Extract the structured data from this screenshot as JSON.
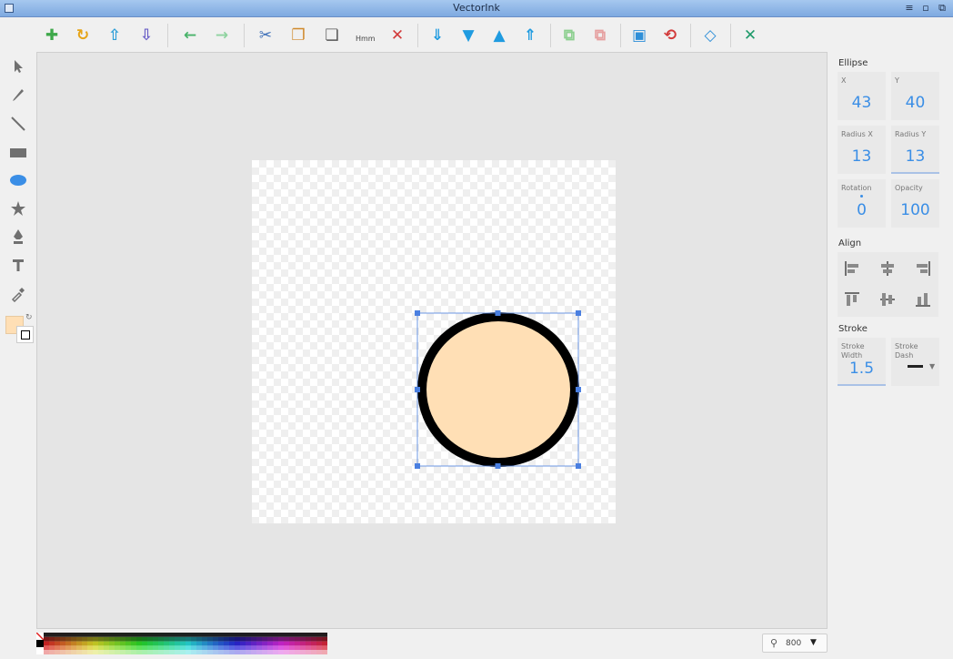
{
  "window": {
    "title": "VectorInk"
  },
  "toolbar": {
    "buttons": [
      {
        "name": "new-icon",
        "glyph": "✚",
        "color": "#3ea84a"
      },
      {
        "name": "reload-icon",
        "glyph": "↻",
        "color": "#e6a417"
      },
      {
        "name": "upload-icon",
        "glyph": "⇧",
        "color": "#2f9fd8"
      },
      {
        "name": "download-icon",
        "glyph": "⇩",
        "color": "#6a5fc7"
      },
      {
        "name": "undo-icon",
        "glyph": "←",
        "color": "#49b36a"
      },
      {
        "name": "redo-icon",
        "glyph": "→",
        "color": "#8fd3a0"
      },
      {
        "name": "cut-icon",
        "glyph": "✂",
        "color": "#3d6fb8"
      },
      {
        "name": "copy-icon",
        "glyph": "❐",
        "color": "#d0892b"
      },
      {
        "name": "paste-icon",
        "glyph": "❏",
        "color": "#555555"
      },
      {
        "name": "delete-icon",
        "glyph": "✕",
        "color": "#d23b3b"
      },
      {
        "name": "bring-to-front-icon",
        "glyph": "⇓",
        "color": "#1f9be0"
      },
      {
        "name": "move-down-icon",
        "glyph": "▼",
        "color": "#1f9be0"
      },
      {
        "name": "move-up-icon",
        "glyph": "▲",
        "color": "#1f9be0"
      },
      {
        "name": "send-to-back-icon",
        "glyph": "⇑",
        "color": "#1f9be0"
      },
      {
        "name": "group-icon",
        "glyph": "⧉",
        "color": "#8ccf8f"
      },
      {
        "name": "ungroup-icon",
        "glyph": "⧉",
        "color": "#e6a0a0"
      },
      {
        "name": "crop-icon",
        "glyph": "▣",
        "color": "#2f8fd8"
      },
      {
        "name": "rotate-icon",
        "glyph": "⟲",
        "color": "#d23b3b"
      },
      {
        "name": "code-icon",
        "glyph": "◇",
        "color": "#2f8fd8"
      },
      {
        "name": "fullscreen-icon",
        "glyph": "✕",
        "color": "#1f9a6a"
      }
    ],
    "paste_caption": "Hmm"
  },
  "tools": [
    {
      "name": "select-tool-icon"
    },
    {
      "name": "pencil-tool-icon"
    },
    {
      "name": "line-tool-icon"
    },
    {
      "name": "rectangle-tool-icon"
    },
    {
      "name": "ellipse-tool-icon",
      "active": true
    },
    {
      "name": "star-tool-icon"
    },
    {
      "name": "pen-tool-icon"
    },
    {
      "name": "text-tool-icon"
    },
    {
      "name": "eyedropper-tool-icon"
    }
  ],
  "colors": {
    "fill": "#ffdfb5",
    "stroke": "#000000",
    "selection": "#4a7fe0",
    "accent": "#3a8ee6"
  },
  "panel": {
    "shape_title": "Ellipse",
    "x_label": "X",
    "x_value": "43",
    "y_label": "Y",
    "y_value": "40",
    "rx_label": "Radius X",
    "rx_value": "13",
    "ry_label": "Radius Y",
    "ry_value": "13",
    "rotation_label": "Rotation",
    "rotation_value": "0",
    "opacity_label": "Opacity",
    "opacity_value": "100",
    "align_title": "Align",
    "stroke_title": "Stroke",
    "stroke_width_label": "Stroke Width",
    "stroke_width_value": "1.5",
    "stroke_dash_label": "Stroke Dash"
  },
  "zoom": {
    "value": "800"
  }
}
